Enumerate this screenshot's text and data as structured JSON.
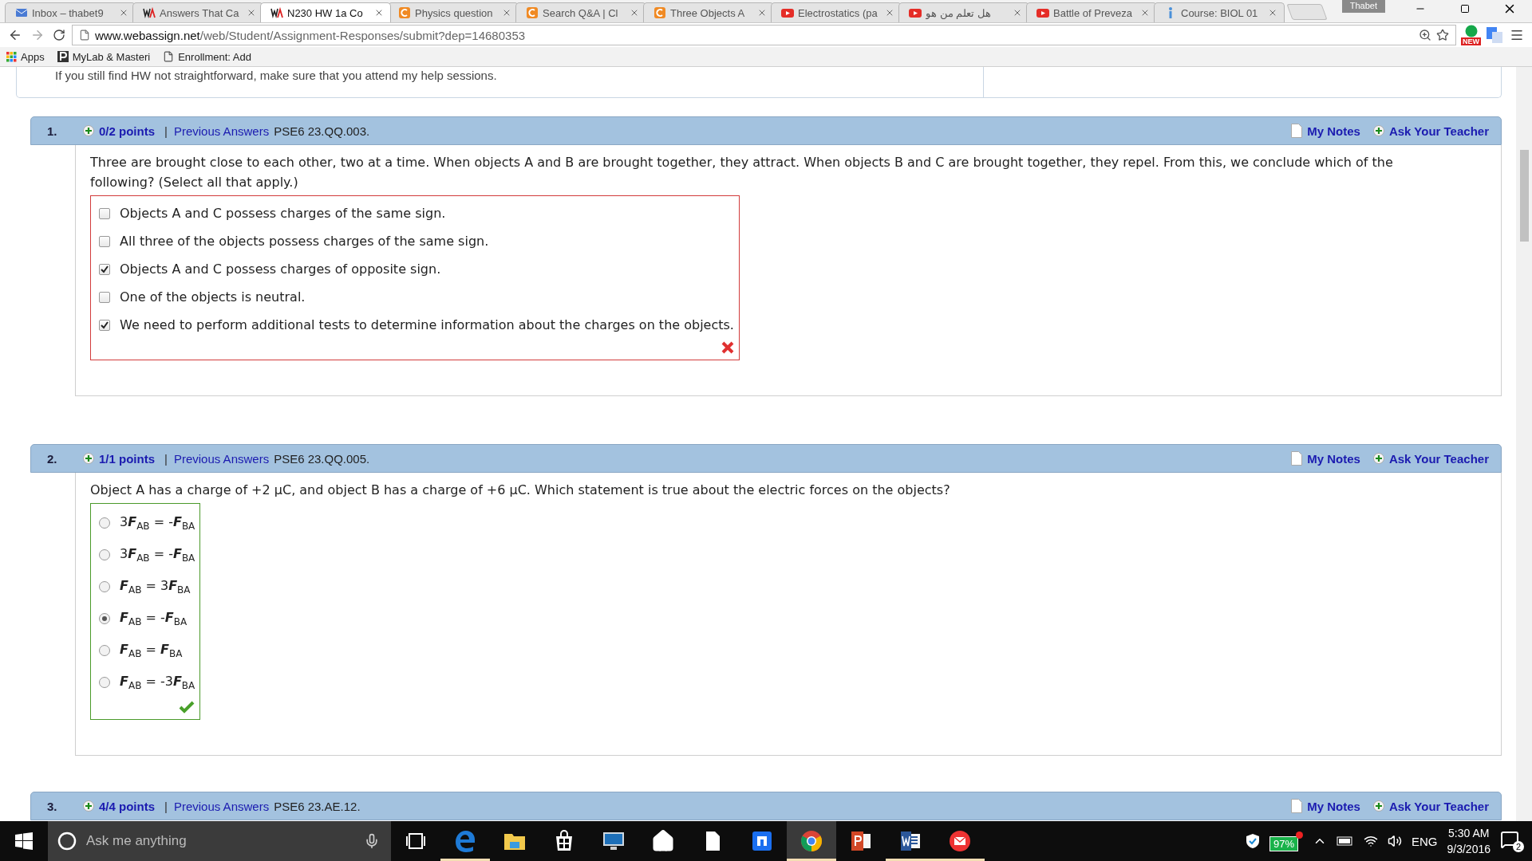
{
  "tabs": [
    {
      "title": "Inbox – thabet9",
      "kind": "mail",
      "selected": false
    },
    {
      "title": "Answers That Ca",
      "kind": "wa",
      "selected": false
    },
    {
      "title": "N230 HW 1a Co",
      "kind": "wa",
      "selected": true
    },
    {
      "title": "Physics question",
      "kind": "chegg",
      "selected": false
    },
    {
      "title": "Search Q&A | Cl",
      "kind": "chegg",
      "selected": false
    },
    {
      "title": "Three Objects A",
      "kind": "chegg",
      "selected": false
    },
    {
      "title": "Electrostatics (pa",
      "kind": "youtube",
      "selected": false
    },
    {
      "title": "هل تعلم من هو",
      "kind": "youtube",
      "selected": false
    },
    {
      "title": "Battle of Preveza",
      "kind": "youtube",
      "selected": false
    },
    {
      "title": "Course: BIOL 01",
      "kind": "info",
      "selected": false
    }
  ],
  "profile": "Thabet",
  "address": {
    "host": "www.webassign.net",
    "path": "/web/Student/Assignment-Responses/submit?dep=14680353"
  },
  "extension_badge": "NEW",
  "bookmarks": [
    {
      "label": "Apps",
      "kind": "apps"
    },
    {
      "label": "MyLab & Masteri",
      "kind": "pearson"
    },
    {
      "label": "Enrollment: Add",
      "kind": "page"
    }
  ],
  "intro": "If you still find HW not straightforward, make sure that you attend my help sessions.",
  "questions": [
    {
      "number": "1.",
      "points": "0/2 points",
      "separator": "|",
      "previous": "Previous Answers",
      "code": "PSE6 23.QQ.003.",
      "notes": "My Notes",
      "ask": "Ask Your Teacher",
      "kind": "checkbox",
      "correct": false,
      "text": "Three are brought close to each other, two at a time. When objects A and B are brought together, they attract. When objects B and C are brought together, they repel. From this, we conclude which of the following? (Select all that apply.)",
      "options": [
        {
          "label": "Objects A and C possess charges of the same sign.",
          "selected": false
        },
        {
          "label": "All three of the objects possess charges of the same sign.",
          "selected": false
        },
        {
          "label": "Objects A and C possess charges of opposite sign.",
          "selected": true
        },
        {
          "label": "One of the objects is neutral.",
          "selected": false
        },
        {
          "label": "We need to perform additional tests to determine information about the charges on the objects.",
          "selected": true
        }
      ]
    },
    {
      "number": "2.",
      "points": "1/1 points",
      "separator": "|",
      "previous": "Previous Answers",
      "code": "PSE6 23.QQ.005.",
      "notes": "My Notes",
      "ask": "Ask Your Teacher",
      "kind": "radio",
      "correct": true,
      "text": "Object A has a charge of +2 μC, and object B has a charge of +6 μC. Which statement is true about the electric forces on the objects?",
      "options": [
        {
          "label": "3**F**$_{AB}$ = -**F**$_{BA}$",
          "selected": false
        },
        {
          "label": "3**F**$_{AB}$ = -**F**$_{BA}$",
          "selected": false
        },
        {
          "label": "**F**$_{AB}$ = 3**F**$_{BA}$",
          "selected": false
        },
        {
          "label": "**F**$_{AB}$ = -**F**$_{BA}$",
          "selected": true
        },
        {
          "label": "**F**$_{AB}$ = **F**$_{BA}$",
          "selected": false
        },
        {
          "label": "**F**$_{AB}$ = -3**F**$_{BA}$",
          "selected": false
        }
      ]
    },
    {
      "number": "3.",
      "points": "4/4 points",
      "separator": "|",
      "previous": "Previous Answers",
      "code": "PSE6 23.AE.12.",
      "notes": "My Notes",
      "ask": "Ask Your Teacher",
      "kind": "partial"
    }
  ],
  "taskbar": {
    "search_placeholder": "Ask me anything",
    "apps": [
      {
        "kind": "edge",
        "running": true,
        "selected": false
      },
      {
        "kind": "explorer",
        "running": false,
        "selected": false
      },
      {
        "kind": "store",
        "running": false,
        "selected": false
      },
      {
        "kind": "monitor",
        "running": false,
        "selected": false
      },
      {
        "kind": "home",
        "running": false,
        "selected": false
      },
      {
        "kind": "file",
        "running": false,
        "selected": false
      },
      {
        "kind": "blueapp",
        "running": false,
        "selected": false
      },
      {
        "kind": "chrome",
        "running": true,
        "selected": true
      },
      {
        "kind": "powerpoint",
        "running": false,
        "selected": false
      },
      {
        "kind": "word",
        "running": true,
        "selected": false
      },
      {
        "kind": "mail",
        "running": true,
        "selected": false
      }
    ],
    "battery": "97%",
    "language": "ENG",
    "time": "5:30 AM",
    "date": "9/3/2016",
    "notifications": "2"
  }
}
